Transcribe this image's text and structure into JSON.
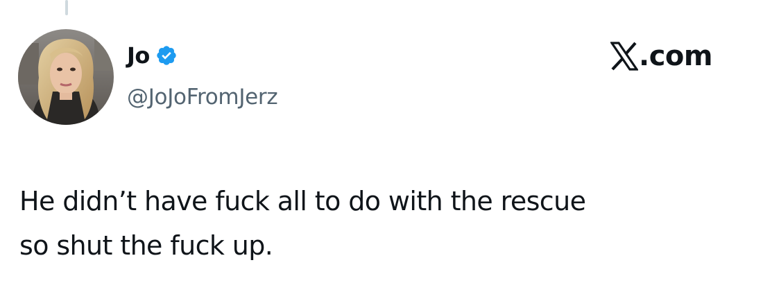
{
  "post": {
    "author": {
      "display_name": "Jo",
      "verified": true,
      "handle": "@JoJoFromJerz"
    },
    "platform": "X.com",
    "text_lines": [
      "He didn’t have fuck all to do with the rescue",
      "so shut the fuck up."
    ]
  },
  "colors": {
    "text": "#0f1419",
    "secondary_text": "#536471",
    "verified_badge": "#1d9bf0",
    "thread_line": "#cfd9de"
  },
  "icons": {
    "verified": "verified-badge-icon",
    "brand": "x-logo-icon"
  }
}
